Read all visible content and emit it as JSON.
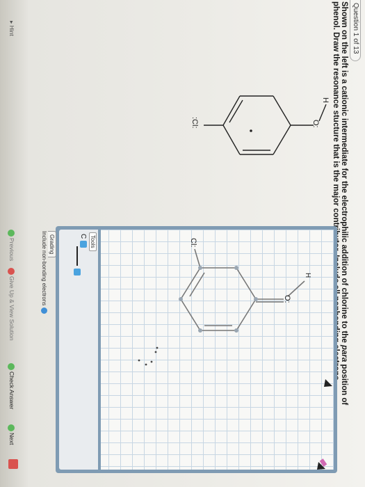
{
  "header": {
    "question_label": "Question 1 of 13"
  },
  "question": {
    "line1_a": "Shown on the left is a cationic intermediate for the electrophilic addition of chlorine to the ",
    "line1_italic": "para",
    "line1_b": " position of",
    "line2": "phenol. Draw the resonance stucture that is the major contributor. Include all nonbonding electrons."
  },
  "static_structure": {
    "h_label": "H",
    "o_label": "O:",
    "cl_label": ":Cl:"
  },
  "canvas_structure": {
    "h_label": "H",
    "o_label": "O:",
    "cl_label": "Cl:"
  },
  "tools": {
    "label": "Tools",
    "element": "C"
  },
  "grading": {
    "label": "Grading",
    "text": "Include non-bonding electrons"
  },
  "nav": {
    "hint": "Hint",
    "previous": "Previous",
    "give_up": "Give Up & View Solution",
    "check": "Check Answer",
    "next": "Next"
  },
  "colors": {
    "panel": "#7f9bb3",
    "grid": "#c7d6e3",
    "accent_blue": "#4aa3df",
    "tool_red": "#d9534f",
    "nav_green": "#5cb85c"
  }
}
